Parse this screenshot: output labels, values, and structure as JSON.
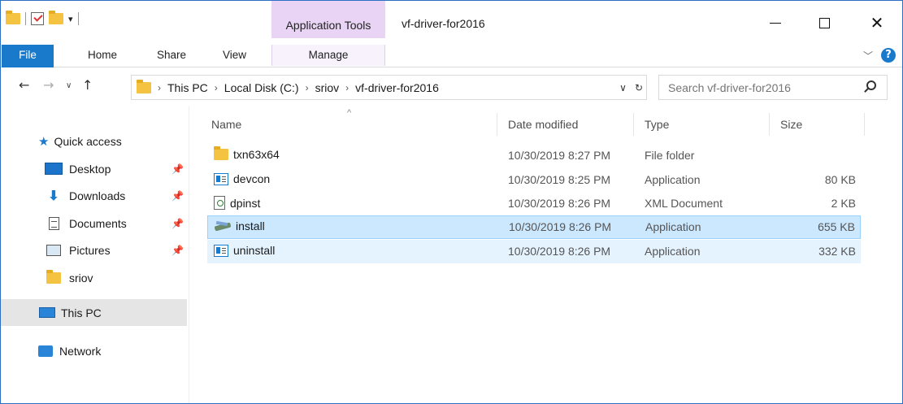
{
  "window": {
    "title": "vf-driver-for2016",
    "context_group": "Application Tools"
  },
  "ribbon": {
    "tabs": [
      {
        "label": "File"
      },
      {
        "label": "Home"
      },
      {
        "label": "Share"
      },
      {
        "label": "View"
      },
      {
        "label": "Manage"
      }
    ]
  },
  "address": {
    "crumbs": [
      "This PC",
      "Local Disk (C:)",
      "sriov",
      "vf-driver-for2016"
    ]
  },
  "search": {
    "placeholder": "Search vf-driver-for2016"
  },
  "nav": {
    "items": [
      {
        "label": "Quick access",
        "icon": "star-icon"
      },
      {
        "label": "Desktop",
        "icon": "desktop-icon",
        "pinned": true
      },
      {
        "label": "Downloads",
        "icon": "downloads-icon",
        "pinned": true
      },
      {
        "label": "Documents",
        "icon": "documents-icon",
        "pinned": true
      },
      {
        "label": "Pictures",
        "icon": "pictures-icon",
        "pinned": true
      },
      {
        "label": "sriov",
        "icon": "folder-icon"
      },
      {
        "label": "This PC",
        "icon": "this-pc-icon",
        "selected": true
      },
      {
        "label": "Network",
        "icon": "network-icon"
      }
    ]
  },
  "columns": {
    "name": "Name",
    "date": "Date modified",
    "type": "Type",
    "size": "Size"
  },
  "files": [
    {
      "name": "txn63x64",
      "date": "10/30/2019 8:27 PM",
      "type": "File folder",
      "size": "",
      "icon": "folder-icon"
    },
    {
      "name": "devcon",
      "date": "10/30/2019 8:25 PM",
      "type": "Application",
      "size": "80 KB",
      "icon": "application-icon"
    },
    {
      "name": "dpinst",
      "date": "10/30/2019 8:26 PM",
      "type": "XML Document",
      "size": "2 KB",
      "icon": "xml-document-icon"
    },
    {
      "name": "install",
      "date": "10/30/2019 8:26 PM",
      "type": "Application",
      "size": "655 KB",
      "icon": "installer-icon",
      "state": "selected"
    },
    {
      "name": "uninstall",
      "date": "10/30/2019 8:26 PM",
      "type": "Application",
      "size": "332 KB",
      "icon": "application-icon",
      "state": "hover"
    }
  ],
  "colors": {
    "accent": "#1979ca",
    "context_tab": "#e9d4f5",
    "selection": "#cce8ff",
    "hover": "#e5f3ff"
  }
}
